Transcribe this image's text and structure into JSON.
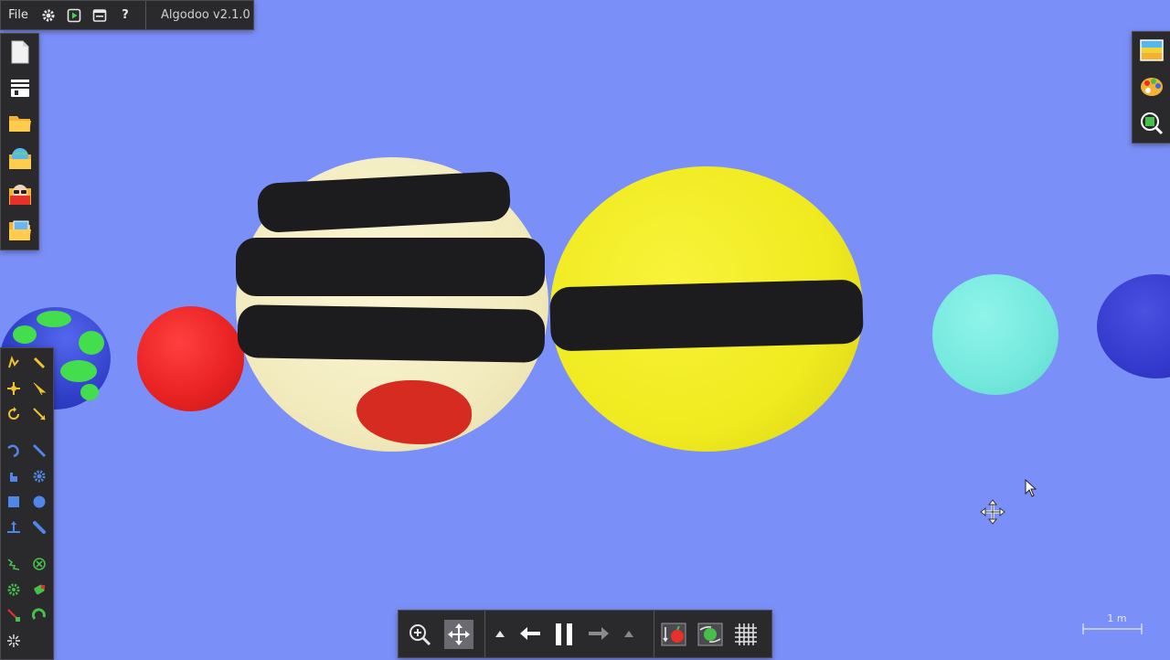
{
  "menubar": {
    "file_label": "File",
    "app_title": "Algodoo v2.1.0",
    "icons": [
      "gear-icon",
      "play-icon",
      "window-icon",
      "help-icon"
    ],
    "help_glyph": "?"
  },
  "left_toolbar": {
    "icons": [
      "new-scene-icon",
      "menu-bar-icon",
      "open-folder-icon",
      "scene-browser-icon",
      "algobox-icon",
      "phunlets-folder-icon"
    ]
  },
  "tools": {
    "icons": [
      "sketch-tool-icon",
      "brush-tool-icon",
      "move-tool-icon",
      "drag-tool-icon",
      "rotate-tool-icon",
      "scale-tool-icon",
      "rope-tool-icon",
      "knife-tool-icon",
      "hand-tool-icon",
      "gear-tool-icon",
      "box-tool-icon",
      "circle-tool-icon",
      "plane-tool-icon",
      "spring-tool-icon",
      "chain-tool-icon",
      "axle-tool-icon",
      "fixate-tool-icon",
      "thruster-tool-icon",
      "laser-tool-icon",
      "tracer-tool-icon",
      "pattern-tool-icon"
    ]
  },
  "right_panel": {
    "icons": [
      "background-icon",
      "palette-icon",
      "camera-zoom-icon"
    ]
  },
  "bottombar": {
    "icons": [
      "zoom-icon",
      "pan-icon",
      "undo-arrow-up-icon",
      "undo-icon",
      "pause-icon",
      "redo-icon",
      "redo-arrow-up-icon",
      "gravity-apple-icon",
      "air-friction-icon",
      "grid-icon"
    ]
  },
  "scale_bar": {
    "label": "1 m"
  },
  "colors": {
    "background": "#7b8ff8",
    "panel": "#2a2a2d",
    "jupiter": "#f6efc6",
    "saturn": "#f2ec22",
    "mars": "#ee2727",
    "uranus": "#7deee2",
    "neptune": "#3a3fd6",
    "earth_land": "#3fd94b",
    "earth_sea": "#3348d3"
  }
}
